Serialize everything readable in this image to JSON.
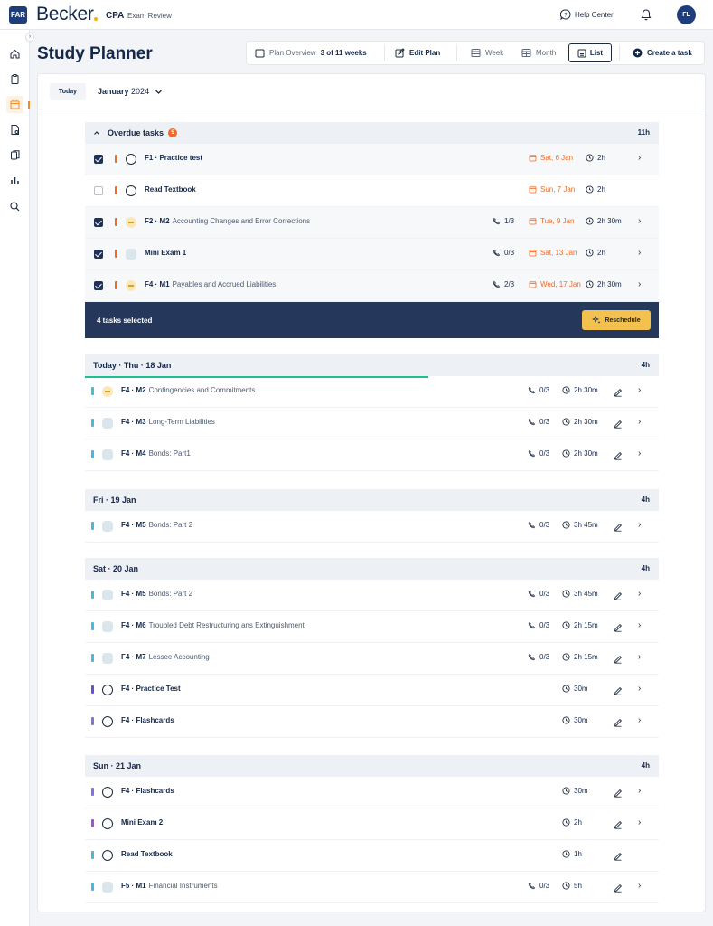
{
  "app": {
    "badge": "FAR",
    "logo": "Becker",
    "product": "CPA",
    "product_sub": "Exam Review",
    "help": "Help Center",
    "avatar": "FL"
  },
  "page": {
    "title": "Study Planner"
  },
  "toolbar": {
    "plan_overview": "Plan Overview",
    "plan_progress": "3 of 11 weeks",
    "edit_plan": "Edit Plan",
    "week": "Week",
    "month": "Month",
    "list": "List",
    "create": "Create a task"
  },
  "datebar": {
    "today": "Today",
    "month": "January",
    "year": "2024"
  },
  "overdue": {
    "title": "Overdue tasks",
    "count": "5",
    "hours": "11h",
    "selected_text": "4 tasks selected",
    "reschedule": "Reschedule",
    "rows": [
      {
        "checked": true,
        "status": "ring",
        "code": "F1 · Practice test",
        "name": "",
        "progress": "",
        "due": "Sat, 6 Jan",
        "time": "2h",
        "chevron": true
      },
      {
        "checked": false,
        "status": "ring",
        "code": "Read Textbook",
        "name": "",
        "progress": "",
        "due": "Sun, 7 Jan",
        "time": "2h",
        "chevron": false
      },
      {
        "checked": true,
        "status": "pending",
        "code": "F2 · M2",
        "name": "Accounting Changes and Error Corrections",
        "progress": "1/3",
        "due": "Tue, 9 Jan",
        "time": "2h 30m",
        "chevron": true
      },
      {
        "checked": true,
        "status": "hex",
        "code": "Mini Exam 1",
        "name": "",
        "progress": "0/3",
        "due": "Sat, 13 Jan",
        "time": "2h",
        "chevron": true
      },
      {
        "checked": true,
        "status": "pending",
        "code": "F4 · M1",
        "name": "Payables and Accrued Liabilities",
        "progress": "2/3",
        "due": "Wed, 17 Jan",
        "time": "2h 30m",
        "chevron": true
      }
    ]
  },
  "days": [
    {
      "title": "Today · Thu · 18 Jan",
      "hours": "4h",
      "rows": [
        {
          "bar": "#4ab8dd",
          "status": "pending",
          "code": "F4 · M2",
          "name": "Contingencies and Commitments",
          "progress": "0/3",
          "time": "2h 30m",
          "edit": true,
          "chevron": true
        },
        {
          "bar": "#4ab8dd",
          "status": "hex",
          "code": "F4 · M3",
          "name": "Long-Term Liabilities",
          "progress": "0/3",
          "time": "2h 30m",
          "edit": true,
          "chevron": true
        },
        {
          "bar": "#4ab8dd",
          "status": "hex",
          "code": "F4 · M4",
          "name": "Bonds: Part1",
          "progress": "0/3",
          "time": "2h 30m",
          "edit": true,
          "chevron": true
        }
      ]
    },
    {
      "title": "Fri · 19 Jan",
      "hours": "4h",
      "rows": [
        {
          "bar": "#4ab8dd",
          "status": "hex",
          "code": "F4 · M5",
          "name": "Bonds: Part 2",
          "progress": "0/3",
          "time": "3h 45m",
          "edit": true,
          "chevron": true
        }
      ]
    },
    {
      "title": "Sat · 20 Jan",
      "hours": "4h",
      "rows": [
        {
          "bar": "#4ab8dd",
          "status": "hex",
          "code": "F4 · M5",
          "name": "Bonds: Part 2",
          "progress": "0/3",
          "time": "3h 45m",
          "edit": true,
          "chevron": true
        },
        {
          "bar": "#4ab8dd",
          "status": "hex",
          "code": "F4 · M6",
          "name": "Troubled Debt Restructuring ans Extinguishment",
          "progress": "0/3",
          "time": "2h 15m",
          "edit": true,
          "chevron": true
        },
        {
          "bar": "#4ab8dd",
          "status": "hex",
          "code": "F4 · M7",
          "name": "Lessee Accounting",
          "progress": "0/3",
          "time": "2h 15m",
          "edit": true,
          "chevron": true
        },
        {
          "bar": "#6a4fc8",
          "status": "ring",
          "code": "F4 · Practice Test",
          "name": "",
          "progress": "",
          "time": "30m",
          "edit": true,
          "chevron": true
        },
        {
          "bar": "#8b6fd8",
          "status": "ring",
          "code": "F4 · Flashcards",
          "name": "",
          "progress": "",
          "time": "30m",
          "edit": true,
          "chevron": true
        }
      ]
    },
    {
      "title": "Sun · 21 Jan",
      "hours": "4h",
      "rows": [
        {
          "bar": "#8b6fd8",
          "status": "ring",
          "code": "F4 · Flashcards",
          "name": "",
          "progress": "",
          "time": "30m",
          "edit": true,
          "chevron": true
        },
        {
          "bar": "#a84fd0",
          "status": "ring",
          "code": "Mini Exam 2",
          "name": "",
          "progress": "",
          "time": "2h",
          "edit": true,
          "chevron": true
        },
        {
          "bar": "#4ab8dd",
          "status": "ring",
          "code": "Read Textbook",
          "name": "",
          "progress": "",
          "time": "1h",
          "edit": true,
          "chevron": false
        },
        {
          "bar": "#4ab8dd",
          "status": "hex",
          "code": "F5 · M1",
          "name": "Financial Instruments",
          "progress": "0/3",
          "time": "5h",
          "edit": true,
          "chevron": true
        }
      ]
    }
  ]
}
